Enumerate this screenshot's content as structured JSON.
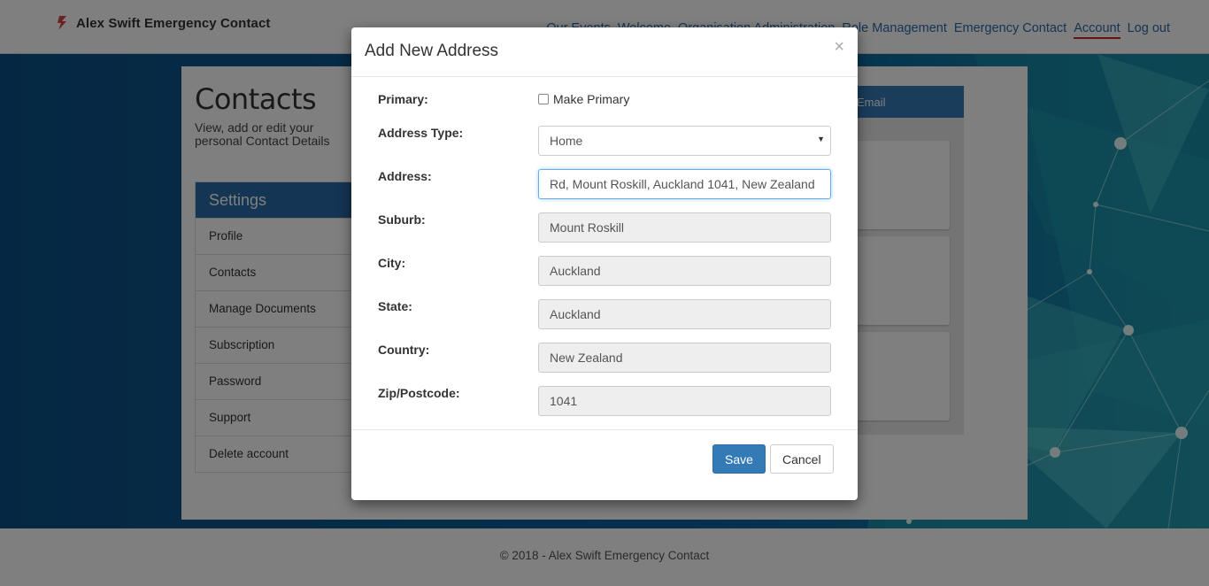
{
  "brand": {
    "title": "Alex Swift Emergency Contact"
  },
  "nav": {
    "items": [
      {
        "label": "Our Events"
      },
      {
        "label": "Welcome"
      },
      {
        "label": "Organisation Administration"
      },
      {
        "label": "Role Management"
      },
      {
        "label": "Emergency Contact"
      },
      {
        "label": "Account",
        "active": true
      },
      {
        "label": "Log out"
      }
    ]
  },
  "page": {
    "title": "Contacts",
    "subtitle": "View, add or edit your personal Contact Details"
  },
  "settings": {
    "header": "Settings",
    "items": [
      {
        "label": "Profile"
      },
      {
        "label": "Contacts"
      },
      {
        "label": "Manage Documents"
      },
      {
        "label": "Subscription"
      },
      {
        "label": "Password"
      },
      {
        "label": "Support"
      },
      {
        "label": "Delete account"
      }
    ]
  },
  "tabs": {
    "email_label": "Email"
  },
  "modal": {
    "title": "Add New Address",
    "close_symbol": "×",
    "fields": {
      "primary": {
        "label": "Primary:",
        "checkbox_label": "Make Primary",
        "checked": false
      },
      "address_type": {
        "label": "Address Type:",
        "value": "Home"
      },
      "address": {
        "label": "Address:",
        "value": "Rd, Mount Roskill, Auckland 1041, New Zealand"
      },
      "suburb": {
        "label": "Suburb:",
        "value": "Mount Roskill"
      },
      "city": {
        "label": "City:",
        "value": "Auckland"
      },
      "state": {
        "label": "State:",
        "value": "Auckland"
      },
      "country": {
        "label": "Country:",
        "value": "New Zealand"
      },
      "zip": {
        "label": "Zip/Postcode:",
        "value": "1041"
      }
    },
    "save_label": "Save",
    "cancel_label": "Cancel"
  },
  "footer": {
    "text": "© 2018 - Alex Swift Emergency Contact"
  },
  "colors": {
    "primary": "#337ab7",
    "active_underline": "#c62828",
    "hero_blue": "#0e5d96",
    "accent_teal": "#1b8aa6"
  }
}
